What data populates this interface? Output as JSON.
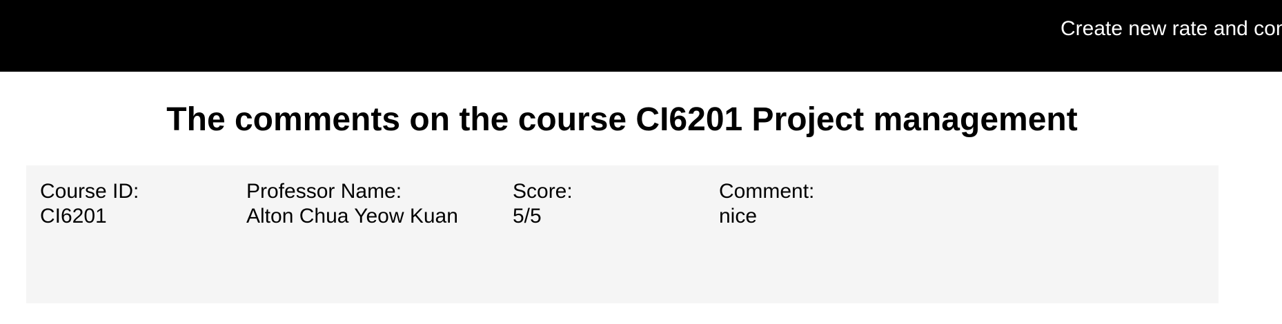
{
  "header": {
    "nav_link": "Create new rate and comment"
  },
  "page": {
    "title": "The comments on the course CI6201 Project management"
  },
  "comments": [
    {
      "course_id_label": "Course ID:",
      "course_id": "CI6201",
      "professor_label": "Professor Name:",
      "professor": "Alton Chua Yeow Kuan",
      "score_label": "Score:",
      "score": "5/5",
      "comment_label": "Comment:",
      "comment": "nice"
    }
  ]
}
